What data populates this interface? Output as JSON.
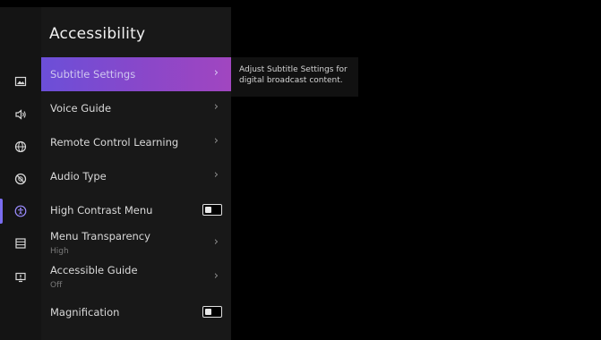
{
  "screen": {
    "title": "Accessibility",
    "description": "Adjust Subtitle Settings for digital broadcast content."
  },
  "rail": [
    {
      "icon": "picture-icon"
    },
    {
      "icon": "sound-icon"
    },
    {
      "icon": "globe-icon"
    },
    {
      "icon": "blocked-icon"
    },
    {
      "icon": "accessibility-icon",
      "active": true
    },
    {
      "icon": "list-icon"
    },
    {
      "icon": "support-icon"
    }
  ],
  "menu": {
    "items": [
      {
        "label": "Subtitle Settings",
        "type": "chevron",
        "selected": true
      },
      {
        "label": "Voice Guide",
        "type": "chevron"
      },
      {
        "label": "Remote Control Learning",
        "type": "chevron"
      },
      {
        "label": "Audio Type",
        "type": "chevron"
      },
      {
        "label": "High Contrast Menu",
        "type": "toggle",
        "value": "off"
      },
      {
        "label": "Menu Transparency",
        "sub": "High",
        "type": "chevron"
      },
      {
        "label": "Accessible Guide",
        "sub": "Off",
        "type": "chevron"
      },
      {
        "label": "Magnification",
        "type": "toggle",
        "value": "off"
      }
    ],
    "chevron": "›"
  },
  "colors": {
    "accent": "#7a6df0",
    "selection_start": "#6b4fd8",
    "selection_end": "#a146c0"
  }
}
